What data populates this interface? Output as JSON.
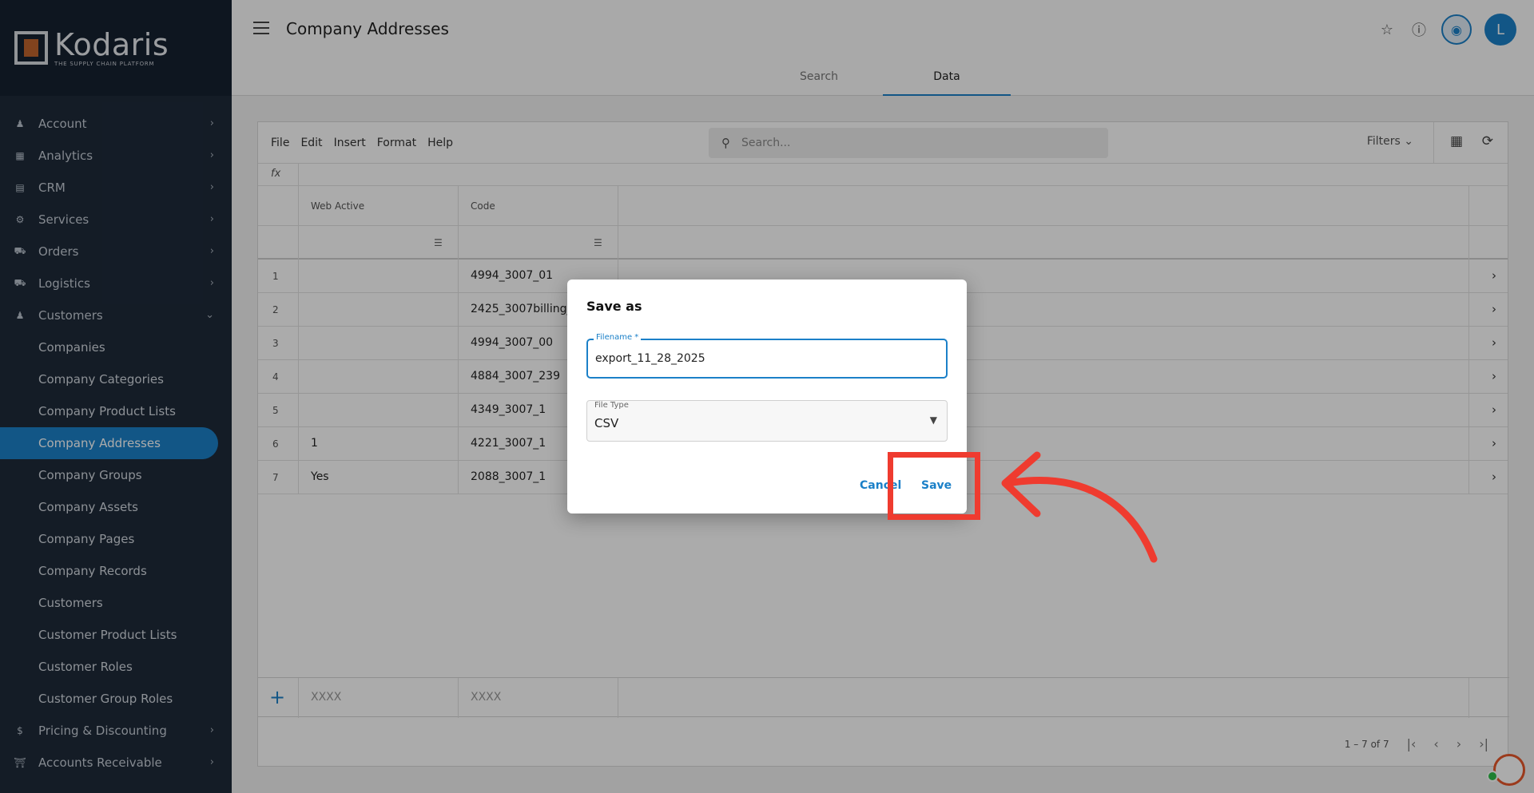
{
  "brand": {
    "name": "Kodaris",
    "tagline": "THE SUPPLY CHAIN PLATFORM"
  },
  "sidebar": {
    "items": [
      {
        "label": "Account",
        "icon": "person-icon"
      },
      {
        "label": "Analytics",
        "icon": "chart-icon"
      },
      {
        "label": "CRM",
        "icon": "contact-card-icon"
      },
      {
        "label": "Services",
        "icon": "gears-icon"
      },
      {
        "label": "Orders",
        "icon": "truck-icon"
      },
      {
        "label": "Logistics",
        "icon": "shipping-icon"
      },
      {
        "label": "Customers",
        "icon": "people-icon"
      }
    ],
    "customers_sub": [
      "Companies",
      "Company Categories",
      "Company Product Lists",
      "Company Addresses",
      "Company Groups",
      "Company Assets",
      "Company Pages",
      "Company Records",
      "Customers",
      "Customer Product Lists",
      "Customer Roles",
      "Customer Group Roles"
    ],
    "bottom_items": [
      {
        "label": "Pricing & Discounting",
        "icon": "dollar-icon"
      },
      {
        "label": "Accounts Receivable",
        "icon": "bank-icon"
      }
    ]
  },
  "header": {
    "title": "Company Addresses",
    "tabs": [
      "Search",
      "Data"
    ],
    "avatar": "L"
  },
  "toolbar": {
    "menus": [
      "File",
      "Edit",
      "Insert",
      "Format",
      "Help"
    ],
    "search_placeholder": "Search...",
    "filters_label": "Filters"
  },
  "grid": {
    "fx_label": "fx",
    "columns": [
      "Web Active",
      "Code"
    ],
    "rows": [
      {
        "num": "1",
        "web_active": "",
        "code": "4994_3007_01"
      },
      {
        "num": "2",
        "web_active": "",
        "code": "2425_3007billing_"
      },
      {
        "num": "3",
        "web_active": "",
        "code": "4994_3007_00"
      },
      {
        "num": "4",
        "web_active": "",
        "code": "4884_3007_239"
      },
      {
        "num": "5",
        "web_active": "",
        "code": "4349_3007_1"
      },
      {
        "num": "6",
        "web_active": "1",
        "code": "4221_3007_1"
      },
      {
        "num": "7",
        "web_active": "Yes",
        "code": "2088_3007_1"
      }
    ],
    "add_row_placeholders": [
      "XXXX",
      "XXXX"
    ],
    "pagination": "1 – 7 of 7"
  },
  "dialog": {
    "title": "Save as",
    "filename_label": "Filename *",
    "filename_value": "export_11_28_2025",
    "filetype_label": "File Type",
    "filetype_value": "CSV",
    "cancel_label": "Cancel",
    "save_label": "Save"
  },
  "colors": {
    "accent": "#1b80c8",
    "sidebar_bg": "#1e2a3a",
    "annotation": "#ef3b2f"
  }
}
